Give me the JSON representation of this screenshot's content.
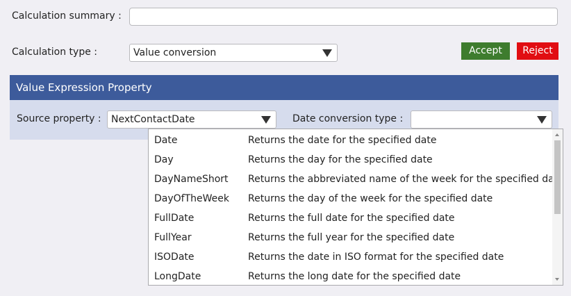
{
  "form": {
    "summary_label": "Calculation summary :",
    "summary_value": "",
    "type_label": "Calculation type :",
    "type_value": "Value conversion",
    "accept_label": "Accept",
    "reject_label": "Reject"
  },
  "section": {
    "title": "Value Expression Property",
    "source_label": "Source property :",
    "source_value": "NextContactDate",
    "date_conv_label": "Date conversion type :",
    "date_conv_value": ""
  },
  "dropdown": {
    "items": [
      {
        "name": "Date",
        "desc": "Returns the date for the specified date"
      },
      {
        "name": "Day",
        "desc": "Returns the day for the specified date"
      },
      {
        "name": "DayNameShort",
        "desc": "Returns the abbreviated name of the week for the specified date"
      },
      {
        "name": "DayOfTheWeek",
        "desc": "Returns the day of the week for the specified date"
      },
      {
        "name": "FullDate",
        "desc": "Returns the full date for the specified date"
      },
      {
        "name": "FullYear",
        "desc": "Returns the full year for the specified date"
      },
      {
        "name": "ISODate",
        "desc": "Returns the date in ISO format for the specified date"
      },
      {
        "name": "LongDate",
        "desc": "Returns the long date for the specified date"
      }
    ]
  },
  "colors": {
    "accept": "#3e7c2e",
    "reject": "#e10d12",
    "section_header": "#3d5b9b",
    "section_body": "#d6dced",
    "background": "#f0eff4"
  }
}
